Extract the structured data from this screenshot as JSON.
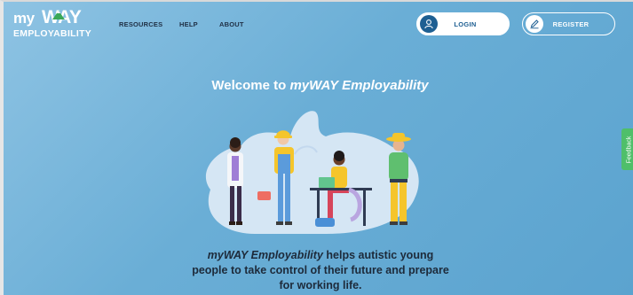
{
  "header": {
    "logo": {
      "line1_my": "my",
      "line1_way": "WAY",
      "line2": "EMPLOYABILITY"
    },
    "nav": [
      "RESOURCES",
      "HELP",
      "ABOUT"
    ],
    "login_label": "LOGIN",
    "register_label": "REGISTER",
    "login_icon": "user-icon",
    "register_icon": "pen-icon"
  },
  "hero": {
    "welcome_prefix": "Welcome to ",
    "welcome_brand": "myWAY Employability",
    "tagline_brand": "myWAY Employability",
    "tagline_rest": " helps autistic young people to take control of their future and prepare for working life."
  },
  "feedback_tab": "Feedback",
  "colors": {
    "background": "#6aaed6",
    "login_accent": "#1e5f92",
    "feedback_tab": "#4fbf6a",
    "text_dark": "#1d2a3a"
  }
}
